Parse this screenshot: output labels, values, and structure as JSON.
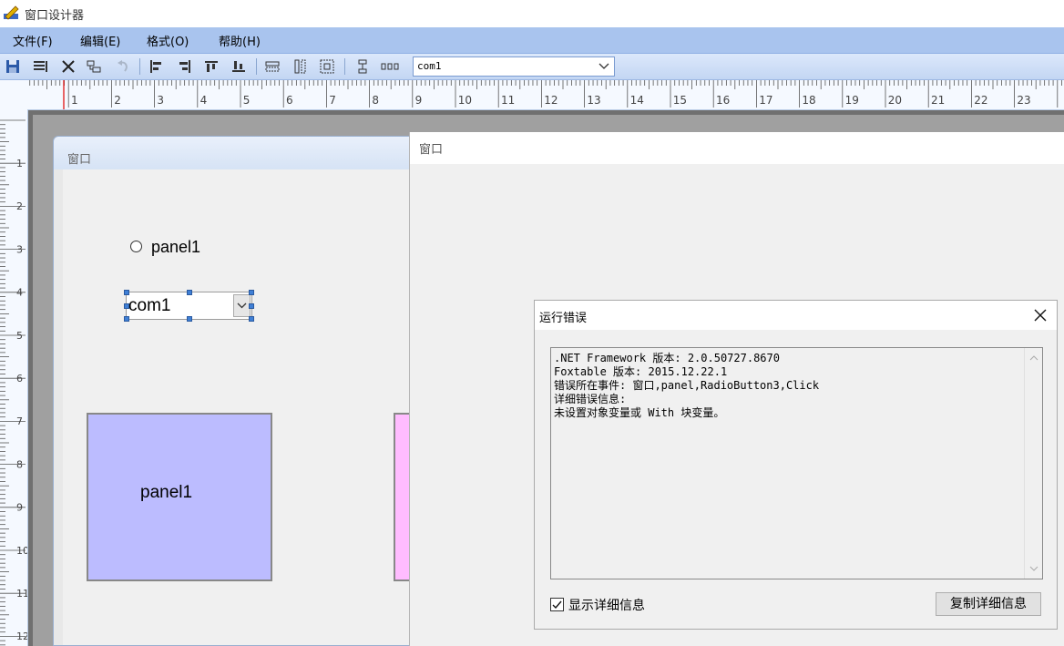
{
  "app": {
    "title": "窗口设计器"
  },
  "menu": {
    "items": [
      "文件(F)",
      "编辑(E)",
      "格式(O)",
      "帮助(H)"
    ]
  },
  "toolbar": {
    "icons": [
      "save-icon",
      "properties-icon",
      "delete-icon",
      "copy-format-icon",
      "undo-icon",
      "align-left-icon",
      "align-right-icon",
      "align-top-icon",
      "align-bottom-icon",
      "same-width-icon",
      "same-height-icon",
      "same-size-icon",
      "vertical-spacing-icon",
      "horizontal-spacing-icon"
    ],
    "object_select_value": "com1"
  },
  "ruler": {
    "h_labels": [
      "1",
      "2",
      "3",
      "4",
      "5",
      "6",
      "7",
      "8",
      "9",
      "10",
      "11",
      "12",
      "13",
      "14",
      "15",
      "16",
      "17",
      "18",
      "19",
      "20",
      "21",
      "22",
      "23"
    ],
    "v_labels": [
      "1",
      "2",
      "3",
      "4",
      "5",
      "6",
      "7",
      "8",
      "9",
      "10",
      "11",
      "12"
    ]
  },
  "design_window": {
    "title": "窗口",
    "radio_label": "panel1",
    "combo_value": "com1",
    "panel1_label": "panel1"
  },
  "run_window": {
    "title": "窗口"
  },
  "error_dialog": {
    "title": "运行错误",
    "details": ".NET Framework 版本: 2.0.50727.8670\nFoxtable 版本: 2015.12.22.1\n错误所在事件: 窗口,panel,RadioButton3,Click\n详细错误信息:\n未设置对象变量或 With 块变量。",
    "show_details_label": "显示详细信息",
    "show_details_checked": true,
    "copy_button_label": "复制详细信息"
  }
}
